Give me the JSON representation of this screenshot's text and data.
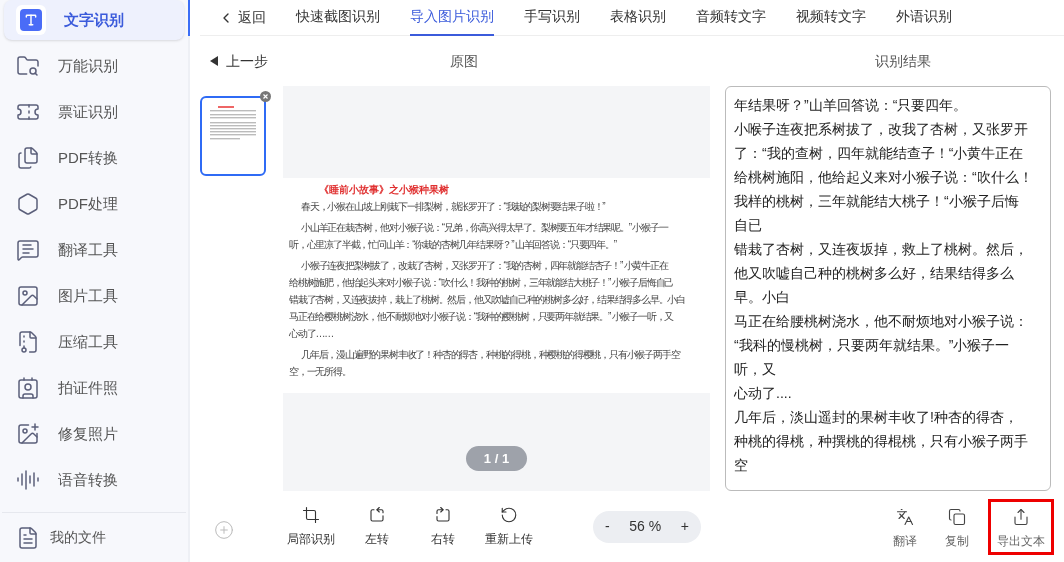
{
  "sidebar": {
    "items": [
      {
        "label": "文字识别",
        "selected": true
      },
      {
        "label": "万能识别",
        "selected": false
      },
      {
        "label": "票证识别",
        "selected": false
      },
      {
        "label": "PDF转换",
        "selected": false
      },
      {
        "label": "PDF处理",
        "selected": false
      },
      {
        "label": "翻译工具",
        "selected": false
      },
      {
        "label": "图片工具",
        "selected": false
      },
      {
        "label": "压缩工具",
        "selected": false
      },
      {
        "label": "拍证件照",
        "selected": false
      },
      {
        "label": "修复照片",
        "selected": false
      },
      {
        "label": "语音转换",
        "selected": false
      }
    ],
    "footer": "我的文件"
  },
  "back": "返回",
  "tabs": [
    {
      "label": "快速截图识别",
      "selected": false
    },
    {
      "label": "导入图片识别",
      "selected": true
    },
    {
      "label": "手写识别",
      "selected": false
    },
    {
      "label": "表格识别",
      "selected": false
    },
    {
      "label": "音频转文字",
      "selected": false
    },
    {
      "label": "视频转文字",
      "selected": false
    },
    {
      "label": "外语识别",
      "selected": false
    }
  ],
  "prev_step": "上一步",
  "original_heading": "原图",
  "result_heading": "识别结果",
  "document": {
    "title": "《睡前小故事》之小猴种果树",
    "paragraphs": [
      [
        "春天，小猴在山坡上刚栽下一排梨树，就张罗开了：“我栽的梨树要结果子啦！”"
      ],
      [
        "小山羊正在栽杏树，他对小猴子说：“兄弟，你高兴得太早了。梨树要五年才结果呢。” 小猴子一",
        "听，心里凉了半截，忙问山羊：“你栽的杏树几年结果呀？” 山羊回答说：“只要四年。”"
      ],
      [
        "小猴子连夜把梨树拔了，改栽了杏树，又张罗开了：“我的杏树，四年就能结杏子！” 小黄牛正在",
        "给桃树施肥，他抬起头来对小猴子说：“吹什么！我种的桃树，三年就能结大桃子！” 小猴子后悔自己",
        "错栽了杏树，又连夜拔掉，栽上了桃树。然后，他又吹嘘自己种的桃树多么好，结果结得多么早。小白",
        "马正在给樱桃树浇水，他不耐烦地对小猴子说：“我种的樱桃树，只要两年就结果。” 小猴子一听，又",
        "心动了……"
      ],
      [
        "几年后，漫山遍野的果树丰收了！种杏的得杏，种桃的得桃，种樱桃的得樱桃，只有小猴子两手空",
        "空，一无所得。"
      ]
    ]
  },
  "page_indicator": "1 / 1",
  "result_lines": [
    "年结果呀？”山羊回答说：“只要四年。",
    "小喉子连夜把系树拔了，改我了杏树，又张罗开",
    "了：“我的查树，四年就能结查子！“小黄牛正在",
    "给桃树施阳，他给起义来对小猴子说：“吹什么！",
    "我样的桃树，三年就能结大桃子！“小猴子后悔",
    "自已",
    "错栽了杏树，又连夜坂掉，救上了桃树。然后，",
    "他又吹嘘自己种的桃树多么好，结果结得多么",
    "早。小白",
    "马正在给腰桃树浇水，他不耐烦地对小猴子说：",
    "“我科的慢桃树，只要两年就结果。”小猴子一",
    "听，又",
    "心动了....",
    "几年后，淡山遥封的果树丰收了!种杏的得杏，",
    "种桃的得桃，种撰桃的得棍桃，只有小猴子两手",
    "空"
  ],
  "tools": [
    "局部识别",
    "左转",
    "右转",
    "重新上传"
  ],
  "zoom": {
    "minus": "-",
    "value": "56 %",
    "plus": "+"
  },
  "actions": [
    {
      "label": "翻译",
      "highlighted": false
    },
    {
      "label": "复制",
      "highlighted": false
    },
    {
      "label": "导出文本",
      "highlighted": true
    }
  ]
}
